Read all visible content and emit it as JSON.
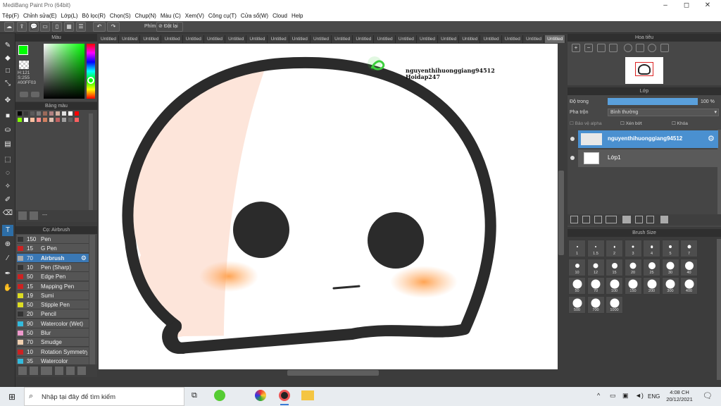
{
  "window": {
    "title": "MediBang Paint Pro (64bit)"
  },
  "menu": [
    "Tệp(F)",
    "Chỉnh sửa(E)",
    "Lớp(L)",
    "Bộ lọc(R)",
    "Chọn(S)",
    "Chụp(N)",
    "Màu (C)",
    "Xem(V)",
    "Công cụ(T)",
    "Cửa sổ(W)",
    "Cloud",
    "Help"
  ],
  "toolbar": {
    "key_label": "Phím",
    "reset_label": "Đặt lại"
  },
  "color_panel": {
    "title": "Màu",
    "h": "H:121",
    "s": "S:255",
    "hex": "#00FF03",
    "primary": "#00ff03"
  },
  "palette_panel": {
    "title": "Bảng màu",
    "swatches": [
      "#000000",
      "#3a3a3a",
      "#5a5a5a",
      "#7a7a7a",
      "#9a6a5a",
      "#b08080",
      "#d0b0a0",
      "#e0e0e0",
      "#ffffff",
      "#ff0000",
      "#80ff00",
      "#ffffff",
      "#ffc0a0",
      "#ff9090",
      "#d08060",
      "#e0c0b0",
      "#c06060",
      "#a0a0a0",
      "#606060",
      "#ff6060"
    ],
    "add_label": "---"
  },
  "brush_panel": {
    "title": "Cọ: Airbrush",
    "items": [
      {
        "size": "150",
        "name": "Pen",
        "color": "#333333"
      },
      {
        "size": "15",
        "name": "G Pen",
        "color": "#cc2222"
      },
      {
        "size": "70",
        "name": "Airbrush",
        "color": "#aaaaaa",
        "selected": true
      },
      {
        "size": "10",
        "name": "Pen (Sharp)",
        "color": "#333333"
      },
      {
        "size": "50",
        "name": "Edge Pen",
        "color": "#cc2222"
      },
      {
        "size": "15",
        "name": "Mapping Pen",
        "color": "#cc2222"
      },
      {
        "size": "19",
        "name": "Sumi",
        "color": "#dddd22"
      },
      {
        "size": "50",
        "name": "Stipple Pen",
        "color": "#dddd22"
      },
      {
        "size": "20",
        "name": "Pencil",
        "color": "#333333"
      },
      {
        "size": "90",
        "name": "Watercolor (Wet)",
        "color": "#33bbdd"
      },
      {
        "size": "50",
        "name": "Blur",
        "color": "#ee99cc"
      },
      {
        "size": "70",
        "name": "Smudge",
        "color": "#f0d0b0"
      },
      {
        "size": "10",
        "name": "Rotation Symmetry",
        "color": "#cc2222"
      },
      {
        "size": "35",
        "name": "Watercolor",
        "color": "#33bbdd"
      }
    ]
  },
  "tabs": [
    "Untitled",
    "Untitled",
    "Untitled",
    "Untitled",
    "Untitled",
    "Untitled",
    "Untitled",
    "Untitled",
    "Untitled",
    "Untitled",
    "Untitled",
    "Untitled",
    "Untitled",
    "Untitled",
    "Untitled",
    "Untitled",
    "Untitled",
    "Untitled",
    "Untitled",
    "Untitled",
    "Untitled",
    "Untitled"
  ],
  "canvas": {
    "watermark_line1": "nguyenthihuonggiang94512",
    "watermark_line2": "Hoidap247"
  },
  "navigator": {
    "title": "Hoa tiêu"
  },
  "layer_panel": {
    "title": "Lớp",
    "opacity_label": "Độ trong",
    "opacity_value": "100 %",
    "opacity_fraction": 1.0,
    "blend_label": "Pha trộn",
    "blend_value": "Bình thường",
    "protect_alpha": "Bảo vệ alpha",
    "clipping": "Xén bớt",
    "lock": "Khóa",
    "layers": [
      {
        "name": "nguyenthihuonggiang94512",
        "selected": true
      },
      {
        "name": "Lớp1",
        "selected": false
      }
    ]
  },
  "brush_size_panel": {
    "title": "Brush Size",
    "sizes": [
      "1",
      "1.5",
      "2",
      "3",
      "4",
      "5",
      "7",
      "10",
      "12",
      "15",
      "20",
      "25",
      "30",
      "40",
      "50",
      "70",
      "100",
      "150",
      "200",
      "300",
      "400",
      "500",
      "700",
      "1000"
    ]
  },
  "taskbar": {
    "search_placeholder": "Nhập tại đây để tìm kiếm",
    "lang": "ENG",
    "time": "4:08 CH",
    "date": "20/12/2021"
  }
}
